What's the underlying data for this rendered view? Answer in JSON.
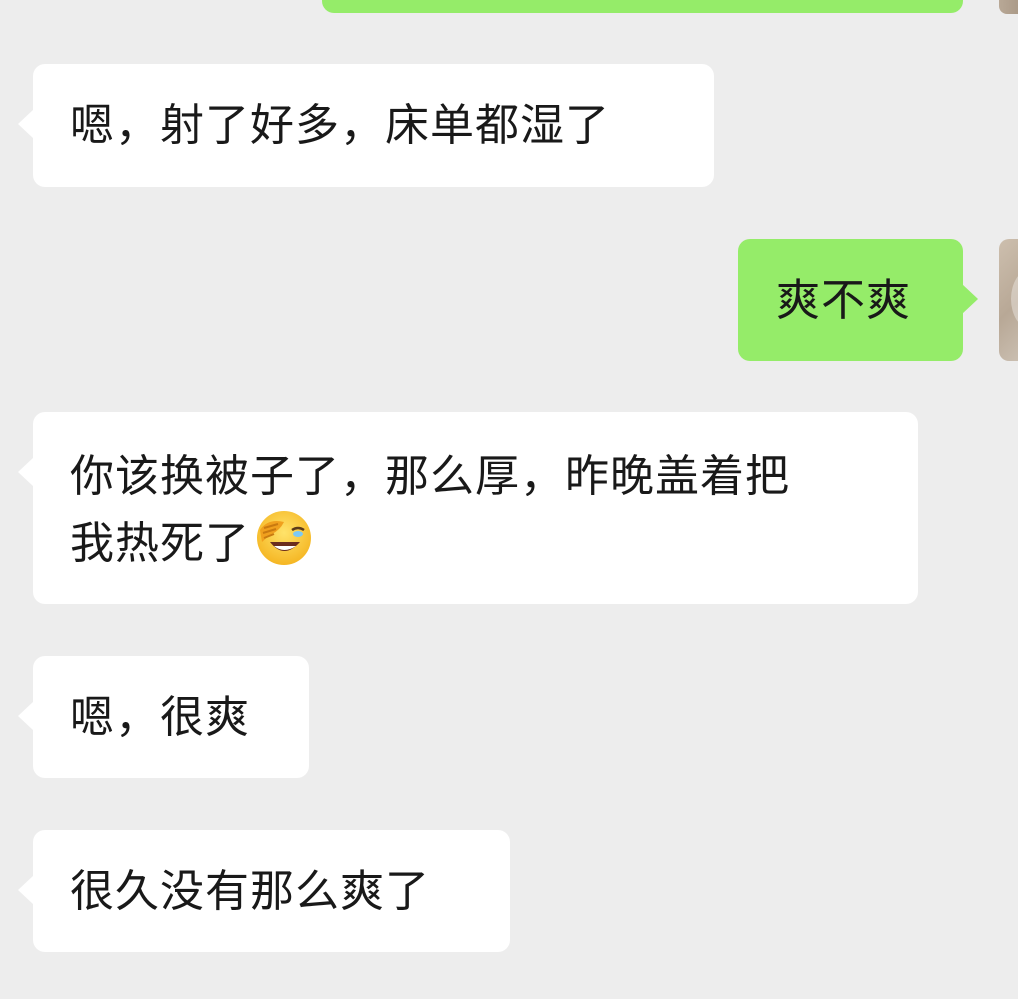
{
  "messages": [
    {
      "side": "in",
      "text": "嗯，射了好多，床单都湿了"
    },
    {
      "side": "out",
      "text": "爽不爽"
    },
    {
      "side": "in",
      "line1": "你该换被子了，那么厚，昨晚盖着把",
      "line2": "我热死了",
      "emoji": "face-palm-laughing-emoji"
    },
    {
      "side": "in",
      "text": "嗯，很爽"
    },
    {
      "side": "in",
      "text": "很久没有那么爽了"
    }
  ],
  "colors": {
    "background": "#ededed",
    "incoming_bubble": "#ffffff",
    "outgoing_bubble": "#95ec69",
    "text": "#191919"
  },
  "icons": {
    "avatar": "user-avatar-photo"
  }
}
